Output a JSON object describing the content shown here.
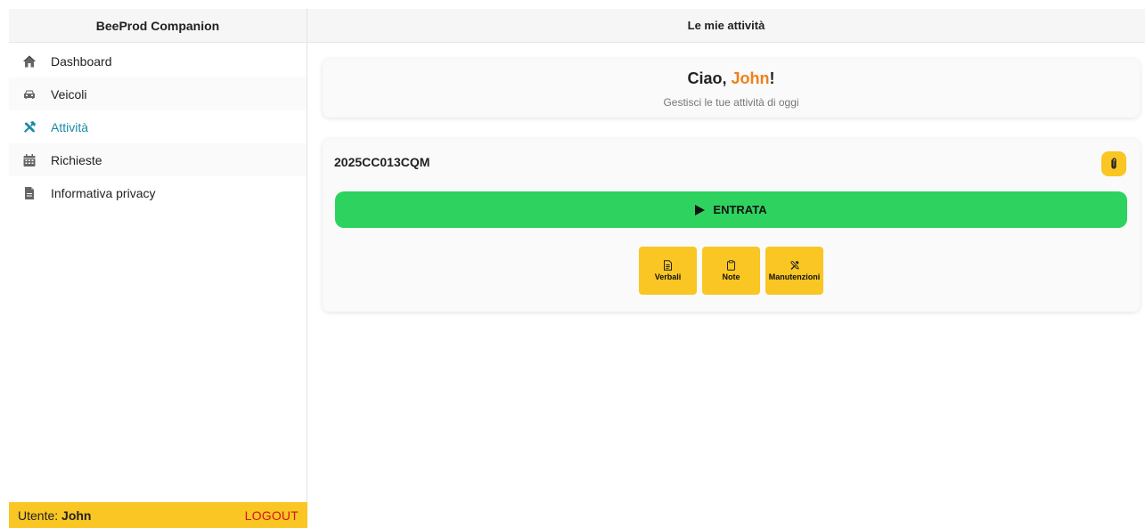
{
  "sidebar": {
    "title": "BeeProd Companion",
    "items": [
      {
        "label": "Dashboard",
        "icon": "home-icon"
      },
      {
        "label": "Veicoli",
        "icon": "car-icon"
      },
      {
        "label": "Attività",
        "icon": "tools-icon",
        "active": true
      },
      {
        "label": "Richieste",
        "icon": "calendar-icon"
      },
      {
        "label": "Informativa privacy",
        "icon": "file-icon"
      }
    ],
    "footer": {
      "user_prefix": "Utente: ",
      "user_name": "John",
      "logout_label": "LOGOUT"
    }
  },
  "main": {
    "title": "Le mie attività",
    "welcome": {
      "greeting": "Ciao, ",
      "name": "John",
      "exclamation": "!",
      "subtitle": "Gestisci le tue attività di oggi"
    },
    "activity": {
      "code": "2025CC013CQM",
      "entrata_label": "ENTRATA",
      "actions": [
        {
          "label": "Verbali",
          "icon": "document-icon"
        },
        {
          "label": "Note",
          "icon": "clipboard-icon"
        },
        {
          "label": "Manutenzioni",
          "icon": "tools-icon"
        }
      ]
    }
  },
  "colors": {
    "accent_yellow": "#f9c623",
    "entrata_green": "#2ed35f",
    "active_link": "#1a8aa8",
    "name_orange": "#f07f1a",
    "logout_red": "#d01818"
  }
}
